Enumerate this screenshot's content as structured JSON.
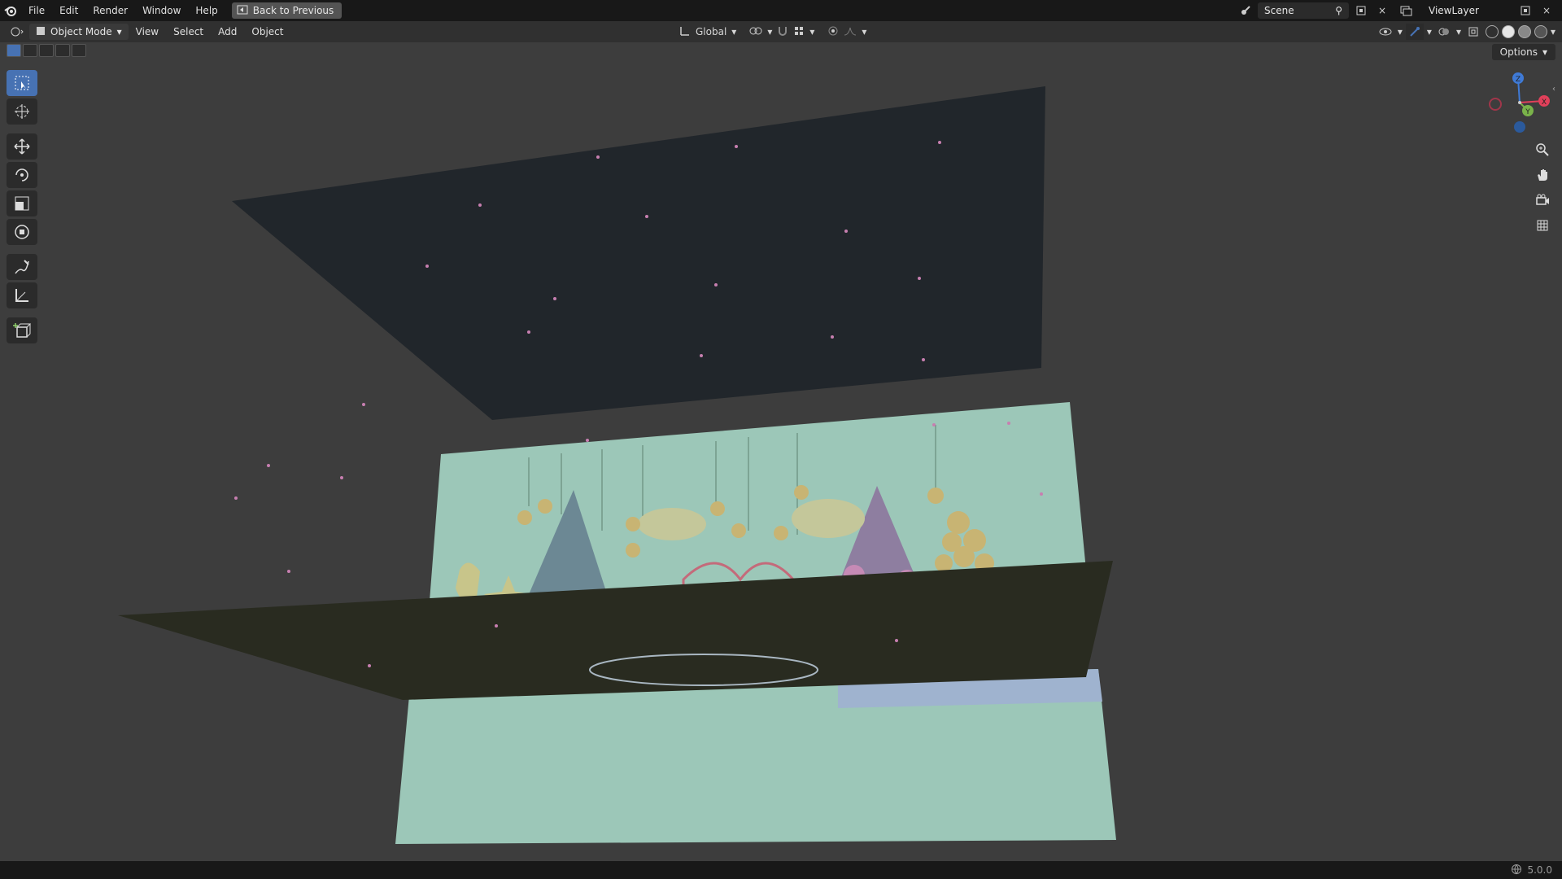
{
  "topbar": {
    "menus": [
      "File",
      "Edit",
      "Render",
      "Window",
      "Help"
    ],
    "back_button": "Back to Previous",
    "scene_label": "Scene",
    "view_layer_label": "ViewLayer"
  },
  "header": {
    "mode": "Object Mode",
    "menus": [
      "View",
      "Select",
      "Add",
      "Object"
    ],
    "orientation": "Global"
  },
  "options_label": "Options",
  "toolbar": {
    "tools": [
      "select-box",
      "cursor",
      "move",
      "rotate",
      "scale",
      "transform",
      "annotate",
      "measure",
      "add-cube"
    ],
    "active": "select-box"
  },
  "navigation": [
    "zoom-icon",
    "hand-pan-icon",
    "camera-icon",
    "grid-view-icon"
  ],
  "gizmo": {
    "x": "X",
    "y": "Y",
    "z": "Z"
  },
  "status": {
    "version": "5.0.0"
  },
  "colors": {
    "accent": "#4772b3",
    "viewport_bg": "#3d3d3d",
    "panel_mint": "#9cc7b8",
    "panel_dark": "#1f252b",
    "axis_x": "#e0405a",
    "axis_y": "#7ab34a",
    "axis_z": "#3f7ad6"
  }
}
